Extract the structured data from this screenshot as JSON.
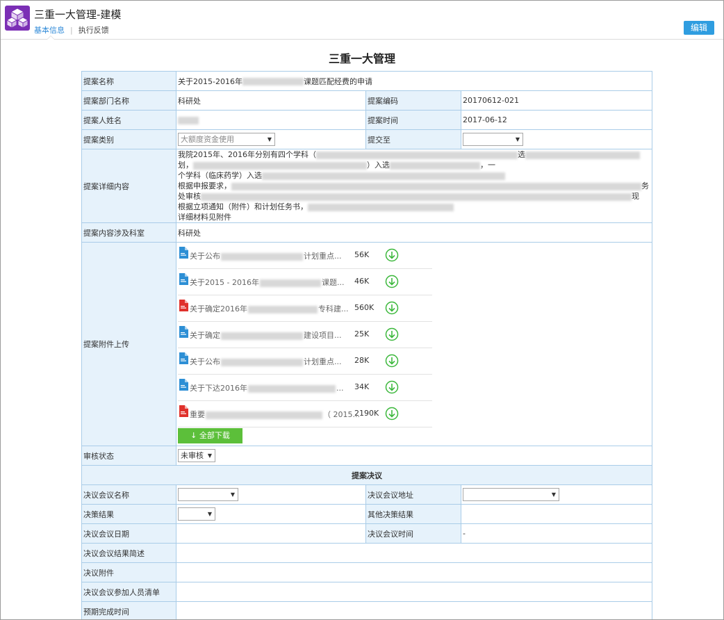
{
  "header": {
    "app_title": "三重一大管理-建模",
    "tabs": [
      {
        "label": "基本信息",
        "active": true
      },
      {
        "label": "执行反馈",
        "active": false
      }
    ],
    "edit_label": "编辑",
    "logo_color": "#7b2fb5",
    "accent_color": "#2f9de0"
  },
  "page": {
    "title": "三重一大管理"
  },
  "form": {
    "proposal_name_label": "提案名称",
    "proposal_name_prefix": "关于2015-2016年",
    "proposal_name_suffix": "课题匹配经费的申请",
    "dept_label": "提案部门名称",
    "dept_value": "科研处",
    "code_label": "提案编码",
    "code_value": "20170612-021",
    "proposer_label": "提案人姓名",
    "time_label": "提案时间",
    "time_value": "2017-06-12",
    "category_label": "提案类别",
    "category_value": "大额度资金使用",
    "submit_to_label": "提交至",
    "submit_to_value": "",
    "detail_label": "提案详细内容",
    "detail_line1": "我院2015年、2016年分别有四个学科（",
    "detail_line1b": "选",
    "detail_line2": "划，",
    "detail_line2b": "）入选",
    "detail_line2c": "，一",
    "detail_line3": "个学科（临床药学）入选",
    "detail_line4": "根据申报要求，",
    "detail_line4b": "务",
    "detail_line5": "处审核",
    "detail_line5b": "现",
    "detail_line6": "根据立项通知（附件）和计划任务书，",
    "detail_line7": "详细材料见附件",
    "dept_involved_label": "提案内容涉及科室",
    "dept_involved_value": "科研处",
    "attachments_label": "提案附件上传",
    "attachments": [
      {
        "type": "doc",
        "prefix": "关于公布",
        "suffix": "计划重点...",
        "size": "56K"
      },
      {
        "type": "doc",
        "prefix": "关于2015 - 2016年",
        "suffix": "课题...",
        "size": "46K"
      },
      {
        "type": "pdf",
        "prefix": "关于确定2016年",
        "suffix": "专科建...",
        "size": "560K"
      },
      {
        "type": "doc",
        "prefix": "关于确定",
        "suffix": "建设项目...",
        "size": "25K"
      },
      {
        "type": "doc",
        "prefix": "关于公布",
        "suffix": "计划重点...",
        "size": "28K"
      },
      {
        "type": "doc",
        "prefix": "关于下达2016年",
        "suffix": "...",
        "size": "34K"
      },
      {
        "type": "pdf",
        "prefix": "重要",
        "suffix": "（ 2015...",
        "size": "2190K"
      }
    ],
    "download_all_label": "全部下载",
    "review_status_label": "审核状态",
    "review_status_value": "未审核",
    "decision_section_title": "提案决议",
    "meeting_name_label": "决议会议名称",
    "meeting_name_value": "",
    "meeting_addr_label": "决议会议地址",
    "meeting_addr_value": "",
    "decision_result_label": "决策结果",
    "decision_result_value": "",
    "other_result_label": "其他决策结果",
    "meeting_date_label": "决议会议日期",
    "meeting_time_label": "决议会议时间",
    "meeting_time_value": "-",
    "meeting_summary_label": "决议会议结果简述",
    "decision_attach_label": "决议附件",
    "attendees_label": "决议会议参加人员清单",
    "expected_done_label": "预期完成时间"
  }
}
